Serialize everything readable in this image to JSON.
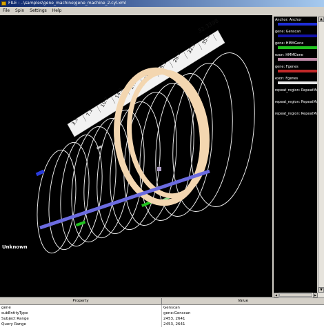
{
  "window": {
    "title": "FILE : ..\\samples\\gene_machine\\gene_machine_2.cyl.xml"
  },
  "menu": [
    "File",
    "Spin",
    "Settings",
    "Help"
  ],
  "viewport": {
    "background": "#000000",
    "ruler_labels": [
      "3.5",
      "7.1",
      "10.7",
      "14.3",
      "17.8",
      "21.4",
      "25.1",
      "28.7",
      "32.3",
      "35.9"
    ],
    "ruler_top_label": "32.3398",
    "unknown_label": "Unknown"
  },
  "legend": {
    "items": [
      {
        "label": "Anchor: Anchor",
        "color": "#1e2ed8"
      },
      {
        "label": "gene: Genscan",
        "color": "#1212a8"
      },
      {
        "label": "gene: HMMGene",
        "color": "#21c21f"
      },
      {
        "label": "exon: HMMGene",
        "color": "#c08aa8"
      },
      {
        "label": "gene: Fgenes",
        "color": "#c02828"
      },
      {
        "label": "exon: Fgenes",
        "color": "#e8e8e8"
      },
      {
        "label": "repeat_region: RepeatMasker",
        "color": ""
      },
      {
        "label": "repeat_region: RepeatMasker",
        "color": ""
      },
      {
        "label": "repeat_region: RepeatMasker",
        "color": ""
      }
    ]
  },
  "properties": {
    "header_property": "Property",
    "header_value": "Value",
    "rows": [
      {
        "property": "gene",
        "value": "Genscan"
      },
      {
        "property": "subEntityType",
        "value": "gene:Genscan"
      },
      {
        "property": "Subject Range",
        "value": "2453, 2641"
      },
      {
        "property": "Query Range",
        "value": "2453, 2641"
      }
    ]
  }
}
